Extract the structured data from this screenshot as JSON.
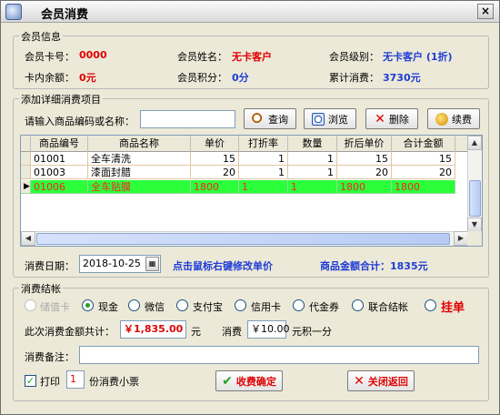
{
  "window": {
    "title": "会员消费",
    "close": "×"
  },
  "member": {
    "legend": "会员信息",
    "card_no_label": "会员卡号：",
    "card_no": "0000",
    "name_label": "会员姓名：",
    "name": "无卡客户",
    "level_label": "会员级别：",
    "level": "无卡客户 (1折)",
    "balance_label": "卡内余额：",
    "balance": "0元",
    "points_label": "会员积分：",
    "points": "0分",
    "total_label": "累计消费：",
    "total": "3730元"
  },
  "items": {
    "legend": "添加详细消费项目",
    "search_label": "请输入商品编码或名称：",
    "search_value": "",
    "query_btn": "查询",
    "browse_btn": "浏览",
    "delete_btn": "删除",
    "renew_btn": "续费",
    "columns": [
      "商品编号",
      "商品名称",
      "单价",
      "打折率",
      "数量",
      "折后单价",
      "合计金额"
    ],
    "rows": [
      [
        "01001",
        "全车清洗",
        "15",
        "1",
        "1",
        "15",
        "15"
      ],
      [
        "01003",
        "漆面封腊",
        "20",
        "1",
        "1",
        "20",
        "20"
      ],
      [
        "01006",
        "全车贴膜",
        "1800",
        "1",
        "1",
        "1800",
        "1800"
      ]
    ],
    "date_label": "消费日期：",
    "date": "2018-10-25",
    "hint": "点击鼠标右键修改单价",
    "sum_label": "商品金额合计：1835元"
  },
  "settle": {
    "legend": "消费结帐",
    "methods": [
      "储值卡",
      "现金",
      "微信",
      "支付宝",
      "信用卡",
      "代金券",
      "联合结帐",
      "挂单"
    ],
    "amount_label": "此次消费金额共计：",
    "amount": "￥1,835.00",
    "amount_unit": "元",
    "consume_label": "消费",
    "consume_value": "￥10.00",
    "consume_suffix": "元积一分",
    "remark_label": "消费备注：",
    "remark": "",
    "print_label": "打印",
    "print_count": "1",
    "print_suffix": "份消费小票",
    "confirm_btn": "收费确定",
    "close_btn": "关闭返回"
  }
}
